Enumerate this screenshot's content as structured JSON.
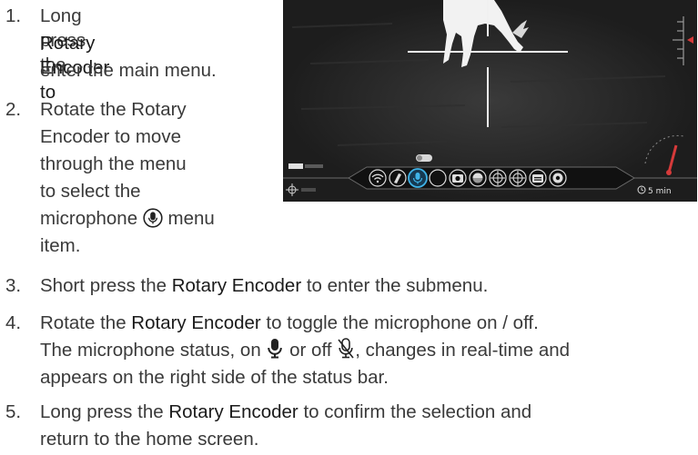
{
  "steps": [
    {
      "number": "1.",
      "lines": [
        "Long press the",
        "Rotary Encoder to",
        "enter the main menu."
      ]
    },
    {
      "number": "2.",
      "lines": [
        "Rotate the Rotary",
        "Encoder to move",
        "through the menu",
        "to select the",
        "microphone",
        "menu",
        "item."
      ]
    },
    {
      "number": "3.",
      "text_a": "Short press the ",
      "highlight": "Rotary Encoder",
      "text_b": " to enter the submenu."
    },
    {
      "number": "4.",
      "text_a": "Rotate the ",
      "highlight": "Rotary Encoder",
      "text_b": " to toggle the microphone on / off.",
      "line2_a": "The microphone status, on",
      "line2_b": "or off",
      "line2_c": ", changes in real-time and",
      "line3": "appears on the right side of the status bar."
    },
    {
      "number": "5.",
      "text_a": "Long press the ",
      "highlight": "Rotary Encoder",
      "text_b": " to confirm the selection and",
      "line2": "return to the home screen."
    }
  ],
  "screen": {
    "timer_label": "5 min",
    "menu_icons": [
      "wifi-icon",
      "compass-icon",
      "microphone-icon",
      "night-mode-icon",
      "camera-icon",
      "palette-icon",
      "reticle-zeroing-icon",
      "reticle-icon",
      "folder-icon",
      "settings-icon"
    ]
  }
}
